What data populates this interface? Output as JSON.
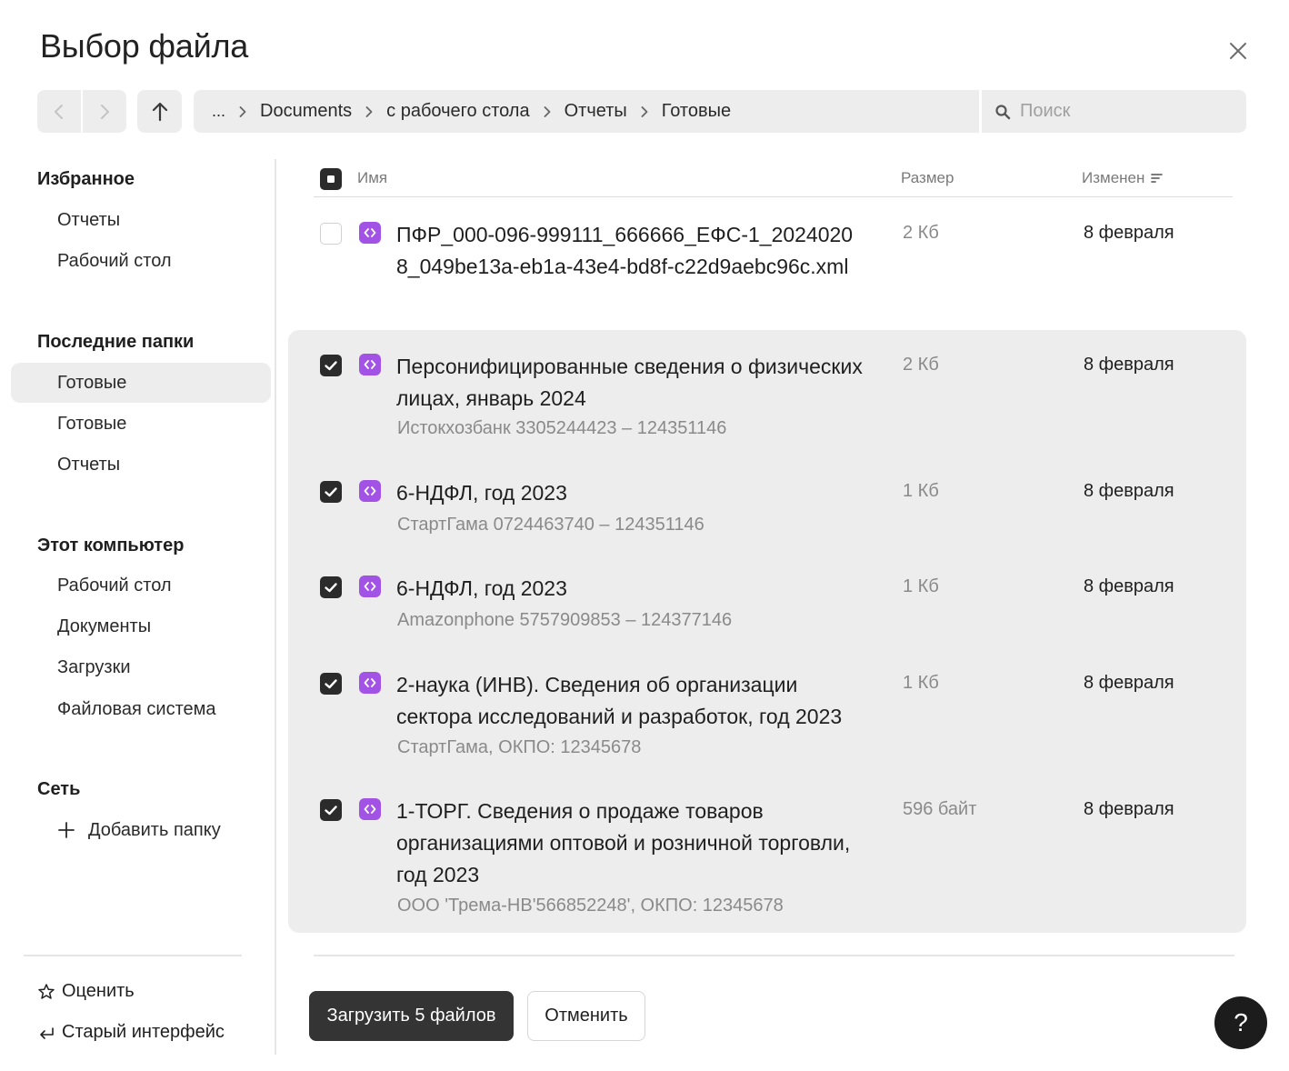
{
  "dialog": {
    "title": "Выбор файла"
  },
  "toolbar": {
    "back_icon": "chevron-left-icon",
    "forward_icon": "chevron-right-icon",
    "up_icon": "arrow-up-icon"
  },
  "breadcrumb": [
    "...",
    "Documents",
    "с рабочего стола",
    "Отчеты",
    "Готовые"
  ],
  "search": {
    "placeholder": "Поиск",
    "value": ""
  },
  "sidebar": {
    "favorites": {
      "title": "Избранное",
      "items": [
        "Отчеты",
        "Рабочий стол"
      ]
    },
    "recent": {
      "title": "Последние папки",
      "items": [
        "Готовые",
        "Готовые",
        "Отчеты"
      ],
      "active_index": 0
    },
    "computer": {
      "title": "Этот компьютер",
      "items": [
        "Рабочий стол",
        "Документы",
        "Загрузки",
        "Файловая система"
      ]
    },
    "network": {
      "title": "Сеть",
      "add_label": "Добавить папку"
    },
    "footer": {
      "rate": "Оценить",
      "old_ui": "Старый интерфейс"
    }
  },
  "table": {
    "headers": {
      "name": "Имя",
      "size": "Размер",
      "modified": "Изменен"
    },
    "rows": [
      {
        "name": "ПФР_000-096-999111_666666_ЕФС-1_20240208_049be13a-eb1a-43e4-bd8f-c22d9aebc96c.xml",
        "sub": "",
        "size": "2 Кб",
        "date": "8 февраля",
        "checked": false
      },
      {
        "name": "Персонифицированные сведения о физических лицах, январь 2024",
        "sub": "Истокхозбанк 3305244423 – 124351146",
        "size": "2 Кб",
        "date": "8 февраля",
        "checked": true
      },
      {
        "name": "6-НДФЛ, год 2023",
        "sub": "СтартГама 0724463740 – 124351146",
        "size": "1 Кб",
        "date": "8 февраля",
        "checked": true
      },
      {
        "name": "6-НДФЛ, год 2023",
        "sub": "Amazonphone 5757909853 – 124377146",
        "size": "1 Кб",
        "date": "8 февраля",
        "checked": true
      },
      {
        "name": "2-наука (ИНВ). Сведения об организации сектора исследований и разработок, год 2023",
        "sub": "СтартГама, ОКПО: 12345678",
        "size": "1 Кб",
        "date": "8 февраля",
        "checked": true
      },
      {
        "name": "1-ТОРГ. Сведения о продаже товаров организациями оптовой и розничной торговли, год 2023",
        "sub": "ООО 'Трема-НВ'566852248', ОКПО: 12345678",
        "size": "596 байт",
        "date": "8 февраля",
        "checked": true
      }
    ]
  },
  "actions": {
    "upload": "Загрузить 5 файлов",
    "cancel": "Отменить",
    "help": "?"
  },
  "colors": {
    "file_icon": "#a352e6",
    "primary_button": "#343434",
    "selection_bg": "#ededed"
  }
}
